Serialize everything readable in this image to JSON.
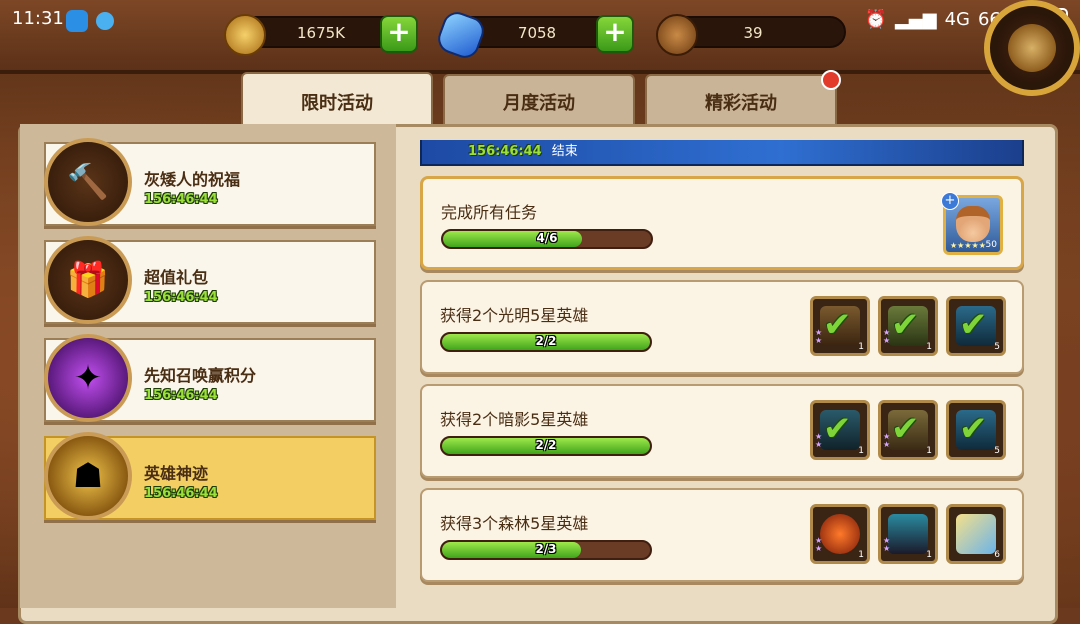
{
  "status_bar": {
    "time": "11:31",
    "battery": "66%",
    "network": "4G"
  },
  "resources": [
    {
      "name": "gold",
      "value": "1675K",
      "icon": "gold-coin-icon",
      "has_plus": true
    },
    {
      "name": "diamond",
      "value": "7058",
      "icon": "blue-gem-icon",
      "has_plus": true
    },
    {
      "name": "stamina",
      "value": "39",
      "icon": "drumstick-icon",
      "has_plus": false
    }
  ],
  "tabs": [
    {
      "label": "限时活动",
      "active": true,
      "notification": false
    },
    {
      "label": "月度活动",
      "active": false,
      "notification": false
    },
    {
      "label": "精彩活动",
      "active": false,
      "notification": true
    }
  ],
  "events": [
    {
      "title": "灰矮人的祝福",
      "time": "156:46:44",
      "icon": "hammer-icon",
      "selected": false
    },
    {
      "title": "超值礼包",
      "time": "156:46:44",
      "icon": "gift-box-icon",
      "selected": false
    },
    {
      "title": "先知召唤赢积分",
      "time": "156:46:44",
      "icon": "purple-summon-icon",
      "selected": false
    },
    {
      "title": "英雄神迹",
      "time": "156:46:44",
      "icon": "golden-hero-icon",
      "selected": true
    }
  ],
  "banner": {
    "time": "156:46:44",
    "text": "结束"
  },
  "tasks": [
    {
      "title": "完成所有任务",
      "progress_text": "4/6",
      "progress": 0.667,
      "reward_type": "hero",
      "hero_level": "50",
      "highlight": true
    },
    {
      "title": "获得2个光明5星英雄",
      "progress_text": "2/2",
      "progress": 1.0,
      "rewards": [
        {
          "level": "1",
          "checked": true
        },
        {
          "level": "1",
          "checked": true
        },
        {
          "level": "5",
          "checked": true
        }
      ]
    },
    {
      "title": "获得2个暗影5星英雄",
      "progress_text": "2/2",
      "progress": 1.0,
      "rewards": [
        {
          "level": "1",
          "checked": true
        },
        {
          "level": "1",
          "checked": true
        },
        {
          "level": "5",
          "checked": true
        }
      ]
    },
    {
      "title": "获得3个森林5星英雄",
      "progress_text": "2/3",
      "progress": 0.667,
      "rewards": [
        {
          "level": "1",
          "checked": false
        },
        {
          "level": "1",
          "checked": false
        },
        {
          "level": "6",
          "checked": false
        }
      ]
    }
  ],
  "colors": {
    "timer_green": "#9be03a",
    "selected_event": "#f3cf63",
    "progress_fill": "#5ccf2a"
  }
}
